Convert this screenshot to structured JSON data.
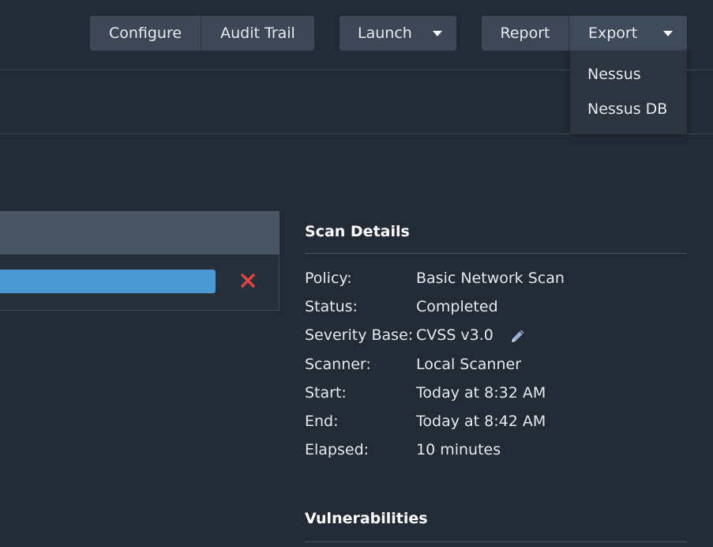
{
  "toolbar": {
    "configure": "Configure",
    "audit_trail": "Audit Trail",
    "launch": "Launch",
    "report": "Report",
    "export": "Export"
  },
  "export_menu": {
    "items": [
      "Nessus",
      "Nessus DB"
    ]
  },
  "progress": {
    "value": 1.0,
    "fill_color": "#4a97d1",
    "cancel_color": "#e0463f"
  },
  "scan_details": {
    "title": "Scan Details",
    "rows": [
      {
        "label": "Policy:",
        "value": "Basic Network Scan"
      },
      {
        "label": "Status:",
        "value": "Completed"
      },
      {
        "label": "Severity Base:",
        "value": "CVSS v3.0"
      },
      {
        "label": "Scanner:",
        "value": "Local Scanner"
      },
      {
        "label": "Start:",
        "value": "Today at 8:32 AM"
      },
      {
        "label": "End:",
        "value": "Today at 8:42 AM"
      },
      {
        "label": "Elapsed:",
        "value": "10 minutes"
      }
    ]
  },
  "vulnerabilities": {
    "title": "Vulnerabilities"
  },
  "colors": {
    "background": "#222a36",
    "button": "#3d4756",
    "accent_blue": "#4a97d1"
  }
}
